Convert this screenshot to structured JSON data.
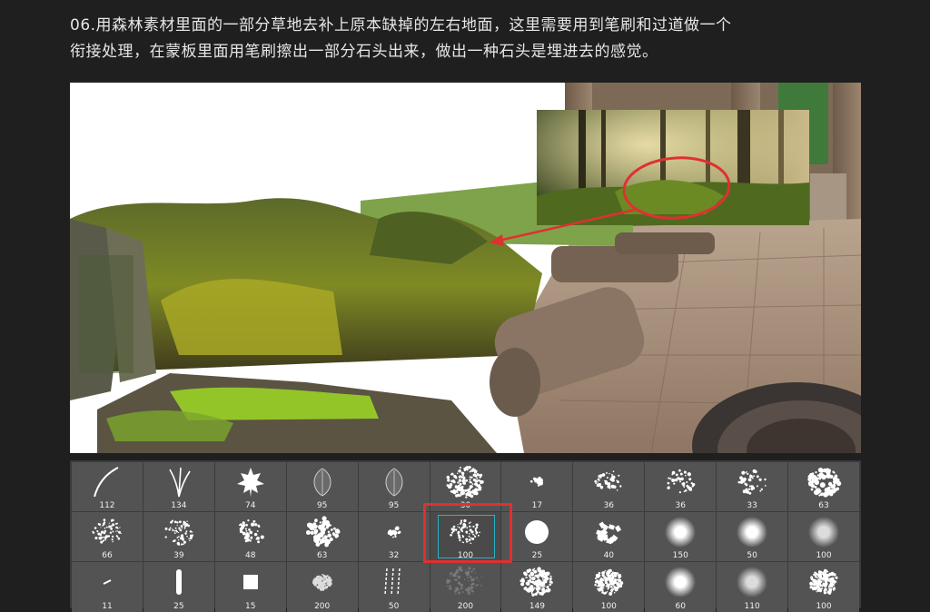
{
  "instruction": {
    "line1": "06.用森林素材里面的一部分草地去补上原本缺掉的左右地面，这里需要用到笔刷和过道做一个",
    "line2": "衔接处理，在蒙板里面用笔刷擦出一部分石头出来，做出一种石头是埋进去的感觉。"
  },
  "colors": {
    "annotation": "#e03030",
    "selection_inner": "#27b3c4",
    "panel_bg": "#3b3b3b",
    "cell_bg": "#535353"
  },
  "brush_panel": {
    "selected_index": 16,
    "brushes": [
      {
        "size": "112",
        "icon": "curved-stroke-icon"
      },
      {
        "size": "134",
        "icon": "grass-blades-icon"
      },
      {
        "size": "74",
        "icon": "maple-leaf-icon"
      },
      {
        "size": "95",
        "icon": "leaf-outline-icon"
      },
      {
        "size": "95",
        "icon": "leaf-outline-icon"
      },
      {
        "size": "30",
        "icon": "texture-square-icon"
      },
      {
        "size": "17",
        "icon": "splatter-small-icon"
      },
      {
        "size": "36",
        "icon": "splatter-icon"
      },
      {
        "size": "36",
        "icon": "splatter-icon"
      },
      {
        "size": "33",
        "icon": "splatter-icon"
      },
      {
        "size": "63",
        "icon": "splatter-large-icon"
      },
      {
        "size": "66",
        "icon": "scatter-dots-icon"
      },
      {
        "size": "39",
        "icon": "scatter-dots-icon"
      },
      {
        "size": "48",
        "icon": "splatter-icon"
      },
      {
        "size": "63",
        "icon": "splatter-large-icon"
      },
      {
        "size": "32",
        "icon": "splatter-small-icon"
      },
      {
        "size": "100",
        "icon": "scatter-dots-icon"
      },
      {
        "size": "25",
        "icon": "hard-round-icon"
      },
      {
        "size": "40",
        "icon": "chunk-scatter-icon"
      },
      {
        "size": "150",
        "icon": "soft-round-icon"
      },
      {
        "size": "50",
        "icon": "soft-round-icon"
      },
      {
        "size": "100",
        "icon": "soft-round-dark-icon"
      },
      {
        "size": "11",
        "icon": "tiny-stroke-icon"
      },
      {
        "size": "25",
        "icon": "vertical-stroke-icon"
      },
      {
        "size": "15",
        "icon": "hard-square-icon"
      },
      {
        "size": "200",
        "icon": "texture-column-icon"
      },
      {
        "size": "50",
        "icon": "rain-streaks-icon"
      },
      {
        "size": "200",
        "icon": "faint-texture-icon"
      },
      {
        "size": "149",
        "icon": "leaf-texture-icon"
      },
      {
        "size": "100",
        "icon": "noise-round-icon"
      },
      {
        "size": "60",
        "icon": "soft-round-icon"
      },
      {
        "size": "110",
        "icon": "soft-round-dark-icon"
      },
      {
        "size": "100",
        "icon": "noise-round-icon"
      }
    ]
  }
}
